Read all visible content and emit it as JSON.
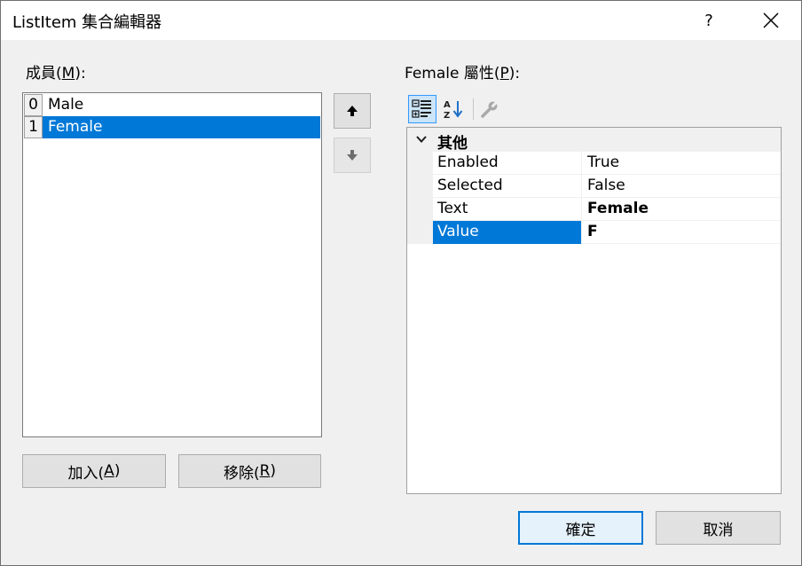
{
  "window": {
    "title": "ListItem 集合編輯器",
    "help_label": "?"
  },
  "members": {
    "label_prefix": "成員(",
    "label_key": "M",
    "label_suffix": "):",
    "items": [
      {
        "index": "0",
        "text": "Male"
      },
      {
        "index": "1",
        "text": "Female"
      }
    ],
    "selected_index": 1
  },
  "buttons": {
    "add_prefix": "加入(",
    "add_key": "A",
    "add_suffix": ")",
    "remove_prefix": "移除(",
    "remove_key": "R",
    "remove_suffix": ")",
    "ok": "確定",
    "cancel": "取消"
  },
  "properties": {
    "label_prefix": "Female 屬性(",
    "label_key": "P",
    "label_suffix": "):",
    "category": "其他",
    "rows": [
      {
        "name": "Enabled",
        "value": "True",
        "bold": false
      },
      {
        "name": "Selected",
        "value": "False",
        "bold": false
      },
      {
        "name": "Text",
        "value": "Female",
        "bold": true
      },
      {
        "name": "Value",
        "value": "F",
        "bold": true
      }
    ],
    "selected_row": "Value"
  },
  "icons": {
    "categorized": "categorized-view-icon",
    "alphabetical": "alphabetical-sort-icon",
    "property_pages": "wrench-icon",
    "move_up": "arrow-up-icon",
    "move_down": "arrow-down-icon"
  },
  "colors": {
    "selection": "#0078d7",
    "accent_border": "#0078d7"
  }
}
